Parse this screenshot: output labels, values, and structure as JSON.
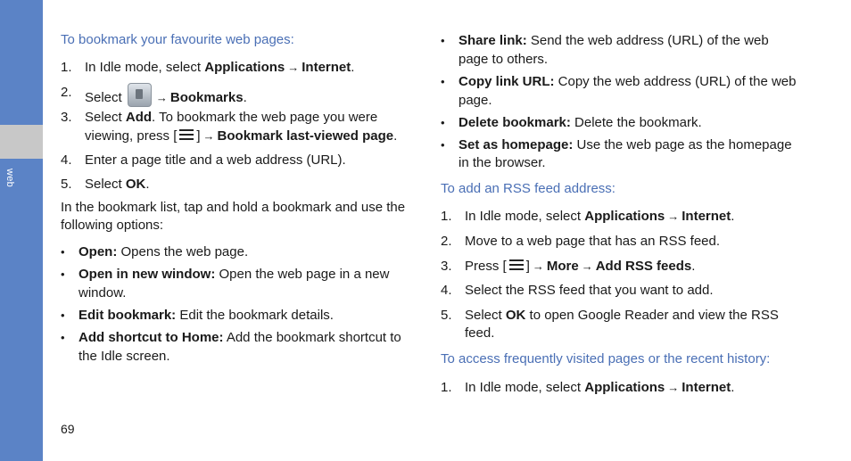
{
  "sidebar": {
    "tab_label": "web"
  },
  "page_number": "69",
  "arrow": "→",
  "left": {
    "heading": "To bookmark your favourite web pages:",
    "steps": [
      {
        "num": "1.",
        "pre": "In Idle mode, select ",
        "b1": "Applications",
        "b2": "Internet",
        "post": "."
      },
      {
        "num": "2.",
        "pre": "Select ",
        "b1": "Bookmarks",
        "post": "."
      },
      {
        "num": "3.",
        "line1_pre": "Select ",
        "line1_b": "Add",
        "line1_post": ". To bookmark the web page you were",
        "line2_pre": "viewing, press [",
        "line2_mid": "]",
        "line2_b": "Bookmark last-viewed page",
        "line2_post": "."
      },
      {
        "num": "4.",
        "text": "Enter a page title and a web address (URL)."
      },
      {
        "num": "5.",
        "pre": "Select ",
        "b1": "OK",
        "post": "."
      }
    ],
    "intro_line1": "In the bookmark list, tap and hold a bookmark and use the",
    "intro_line2": "following options:",
    "options": [
      {
        "b": "Open:",
        "l1": " Opens the web page."
      },
      {
        "b": "Open in new window:",
        "l1": " Open the web page in a new",
        "l2": "window."
      },
      {
        "b": "Edit bookmark:",
        "l1": " Edit the bookmark details."
      },
      {
        "b": "Add shortcut to Home:",
        "l1": " Add the bookmark shortcut to",
        "l2": "the Idle screen."
      }
    ]
  },
  "right": {
    "options": [
      {
        "b": "Share link:",
        "l1": " Send the web address (URL) of the web",
        "l2": "page to others."
      },
      {
        "b": "Copy link URL:",
        "l1": " Copy the web address (URL) of the web",
        "l2": "page."
      },
      {
        "b": "Delete bookmark:",
        "l1": " Delete the bookmark."
      },
      {
        "b": "Set as homepage:",
        "l1": " Use the web page as the homepage",
        "l2": "in the browser."
      }
    ],
    "rss_heading": "To add an RSS feed address:",
    "rss_steps": [
      {
        "num": "1.",
        "pre": "In Idle mode, select ",
        "b1": "Applications",
        "b2": "Internet",
        "post": "."
      },
      {
        "num": "2.",
        "text": "Move to a web page that has an RSS feed."
      },
      {
        "num": "3.",
        "pre": "Press [",
        "mid": "]",
        "b1": "More",
        "b2": "Add RSS feeds",
        "post": "."
      },
      {
        "num": "4.",
        "text": "Select the RSS feed that you want to add."
      },
      {
        "num": "5.",
        "pre": "Select ",
        "b1": "OK",
        "l1_post": " to open Google Reader and view the RSS",
        "l2": "feed."
      }
    ],
    "history_heading": "To access frequently visited pages or the recent history:",
    "history_steps": [
      {
        "num": "1.",
        "pre": "In Idle mode, select ",
        "b1": "Applications",
        "b2": "Internet",
        "post": "."
      }
    ]
  }
}
